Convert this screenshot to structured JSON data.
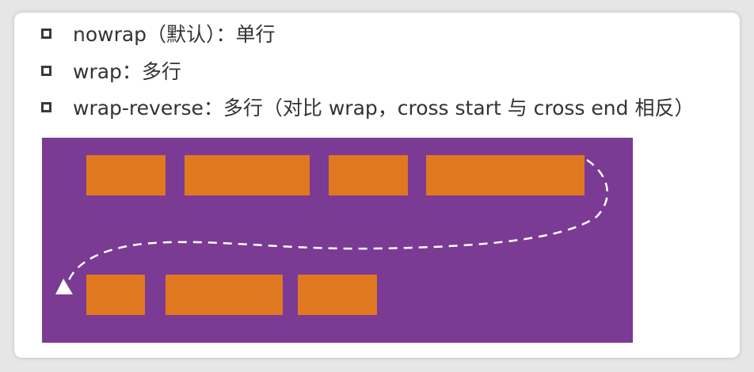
{
  "bullets": [
    {
      "text": "nowrap（默认）：单行"
    },
    {
      "text": "wrap：多行"
    },
    {
      "text": "wrap-reverse：多行（对比 wrap，cross start 与 cross end 相反）"
    }
  ],
  "diagram": {
    "background_color": "#7b3a93",
    "item_color": "#e07820",
    "rows": [
      {
        "item_count": 4
      },
      {
        "item_count": 3
      }
    ],
    "path_style": "white dashed arrow"
  }
}
